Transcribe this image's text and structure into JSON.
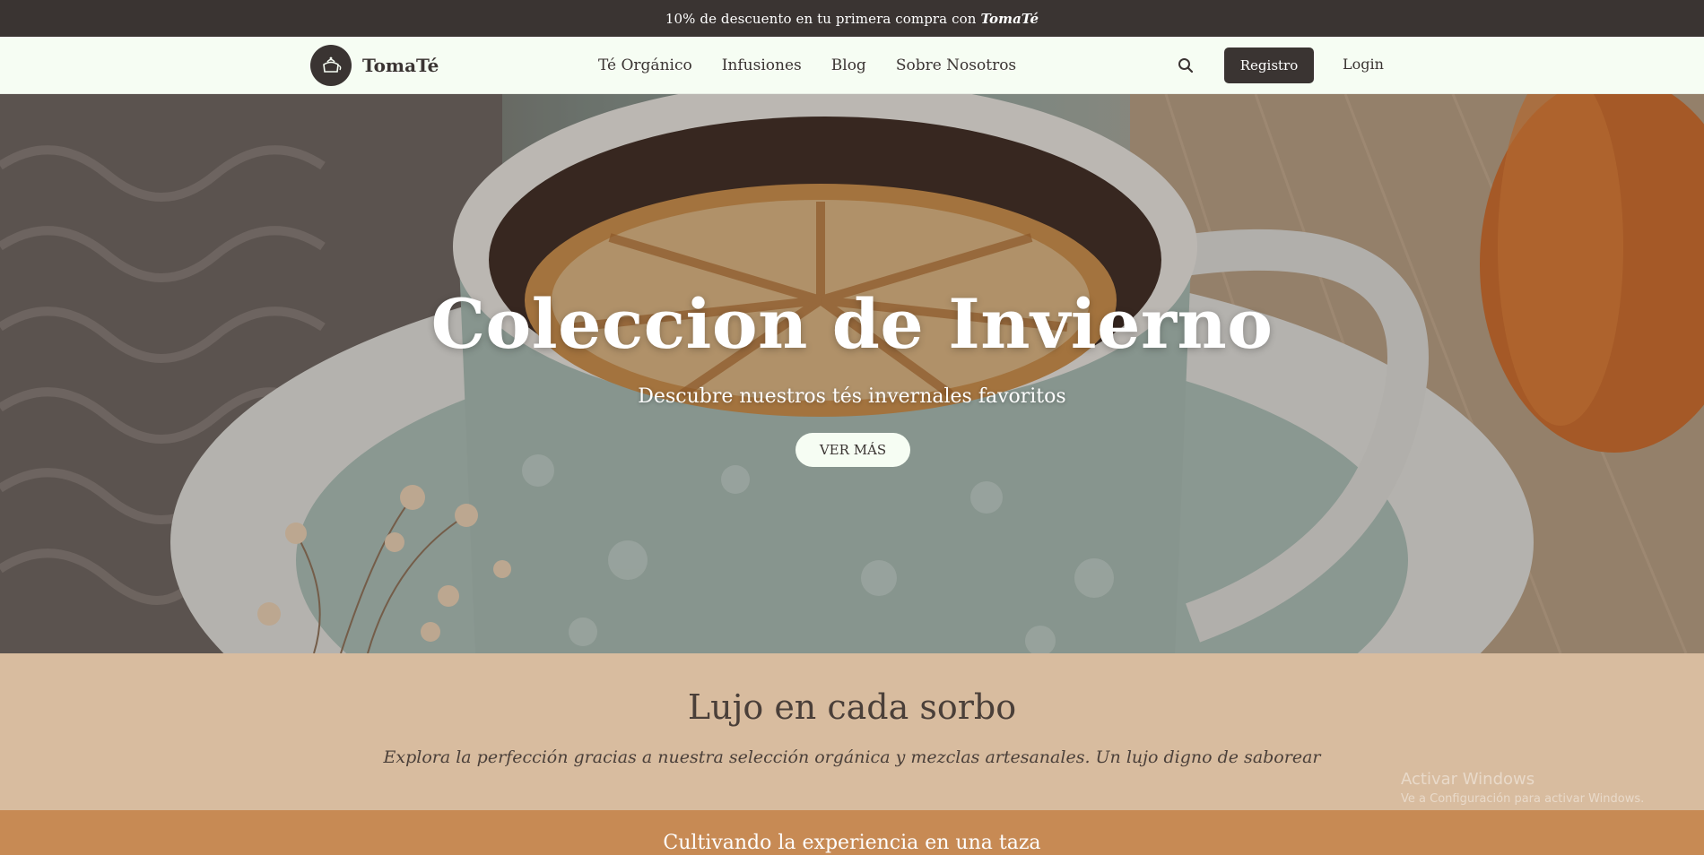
{
  "promo": {
    "text": "10% de descuento en tu primera compra con",
    "brand": "TomaTé"
  },
  "header": {
    "logo_text": "TomaTé",
    "nav": [
      "Té Orgánico",
      "Infusiones",
      "Blog",
      "Sobre Nosotros"
    ],
    "registro_label": "Registro",
    "login_label": "Login"
  },
  "hero": {
    "title": "Coleccion de Invierno",
    "subtitle": "Descubre nuestros tés invernales favoritos",
    "cta_label": "VER MÁS"
  },
  "lujo": {
    "title": "Lujo en cada sorbo",
    "description": "Explora la perfección gracias a nuestra selección orgánica y mezclas artesanales. Un lujo digno de saborear"
  },
  "cultivando": {
    "title": "Cultivando la experiencia en una taza"
  },
  "windows_watermark": {
    "line1": "Activar Windows",
    "line2": "Ve a Configuración para activar Windows."
  },
  "colors": {
    "dark": "#3a3432",
    "header_bg": "#f6fdf3",
    "lujo_bg": "#d8bc9f",
    "cultivando_bg": "#c78a54"
  },
  "icons": {
    "logo": "teapot-icon",
    "search": "search-icon"
  }
}
